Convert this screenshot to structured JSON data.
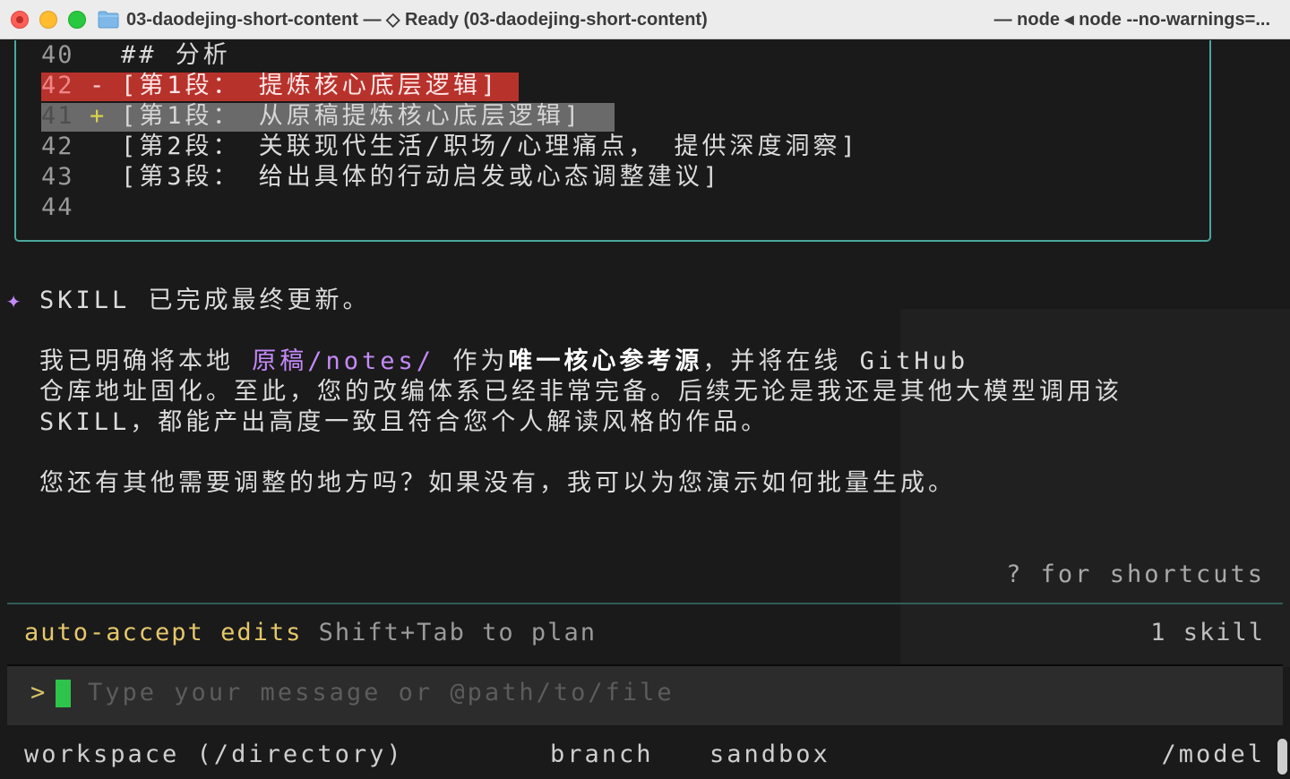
{
  "window": {
    "title": "03-daodejing-short-content — ◇ Ready (03-daodejing-short-content)",
    "title_right": "— node ◂ node --no-warnings=..."
  },
  "diff": {
    "rows": [
      {
        "num": "40",
        "sign": "",
        "text": "## 分析",
        "kind": "context"
      },
      {
        "num": "42",
        "sign": "-",
        "text": "[第1段： 提炼核心底层逻辑]",
        "kind": "deleted"
      },
      {
        "num": "41",
        "sign": "+",
        "text": "[第1段： 从原稿提炼核心底层逻辑]",
        "kind": "added"
      },
      {
        "num": "42",
        "sign": "",
        "text": "[第2段： 关联现代生活/职场/心理痛点， 提供深度洞察]",
        "kind": "context"
      },
      {
        "num": "43",
        "sign": "",
        "text": "[第3段： 给出具体的行动启发或心态调整建议]",
        "kind": "context"
      },
      {
        "num": "44",
        "sign": "",
        "text": "",
        "kind": "context"
      }
    ]
  },
  "message": {
    "star": "✦",
    "headline": "SKILL 已完成最终更新。",
    "p1": {
      "a": "我已明确将本地 ",
      "path": "原稿/notes/",
      "b": " 作为",
      "bold": "唯一核心参考源",
      "c": "，并将在线 GitHub",
      "line2": "仓库地址固化。至此，您的改编体系已经非常完备。后续无论是我还是其他大模型调用该",
      "line3": "SKILL，都能产出高度一致且符合您个人解读风格的作品。"
    },
    "p2": "您还有其他需要调整的地方吗？如果没有，我可以为您演示如何批量生成。"
  },
  "hint": "? for shortcuts",
  "status": {
    "mode": "auto-accept edits",
    "mode_hint": "Shift+Tab to plan",
    "skills": "1 skill"
  },
  "input": {
    "prompt": ">",
    "placeholder": "Type your message or @path/to/file"
  },
  "footer": {
    "workspace": "workspace (/directory)",
    "branch": "branch",
    "sandbox": "sandbox",
    "model": "/model"
  },
  "colors": {
    "accent_teal": "#4aa89e",
    "deleted_bg": "#b8322c",
    "added_bg": "#6a6a6a",
    "path_purple": "#c58af9",
    "mode_yellow": "#e5c76b",
    "cursor_green": "#2ec34a"
  }
}
